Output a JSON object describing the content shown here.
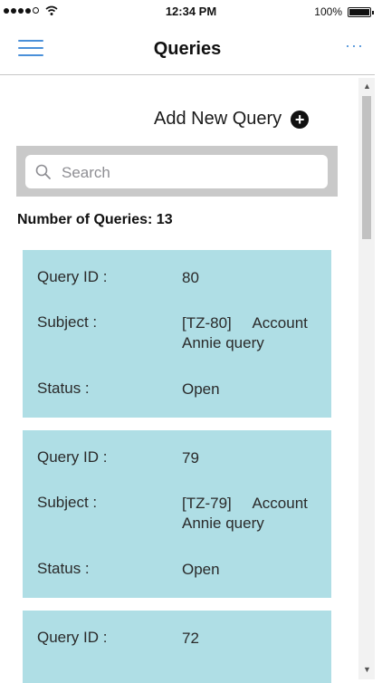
{
  "status_bar": {
    "time": "12:34 PM",
    "battery": "100%"
  },
  "nav": {
    "title": "Queries",
    "more": "···"
  },
  "add_query": {
    "label": "Add New Query"
  },
  "search": {
    "placeholder": "Search"
  },
  "count_text": "Number of Queries: 13",
  "labels": {
    "query_id": "Query ID :",
    "subject": "Subject :",
    "status": "Status :"
  },
  "queries": [
    {
      "id": "80",
      "subject_line1": "[TZ-80]     Account",
      "subject_line2": "Annie query",
      "status": "Open"
    },
    {
      "id": "79",
      "subject_line1": "[TZ-79]     Account",
      "subject_line2": "Annie query",
      "status": "Open"
    },
    {
      "id": "72"
    }
  ],
  "colors": {
    "card_bg": "#afdee5",
    "accent": "#4a90d9",
    "search_bar_bg": "#c9c9c9"
  }
}
